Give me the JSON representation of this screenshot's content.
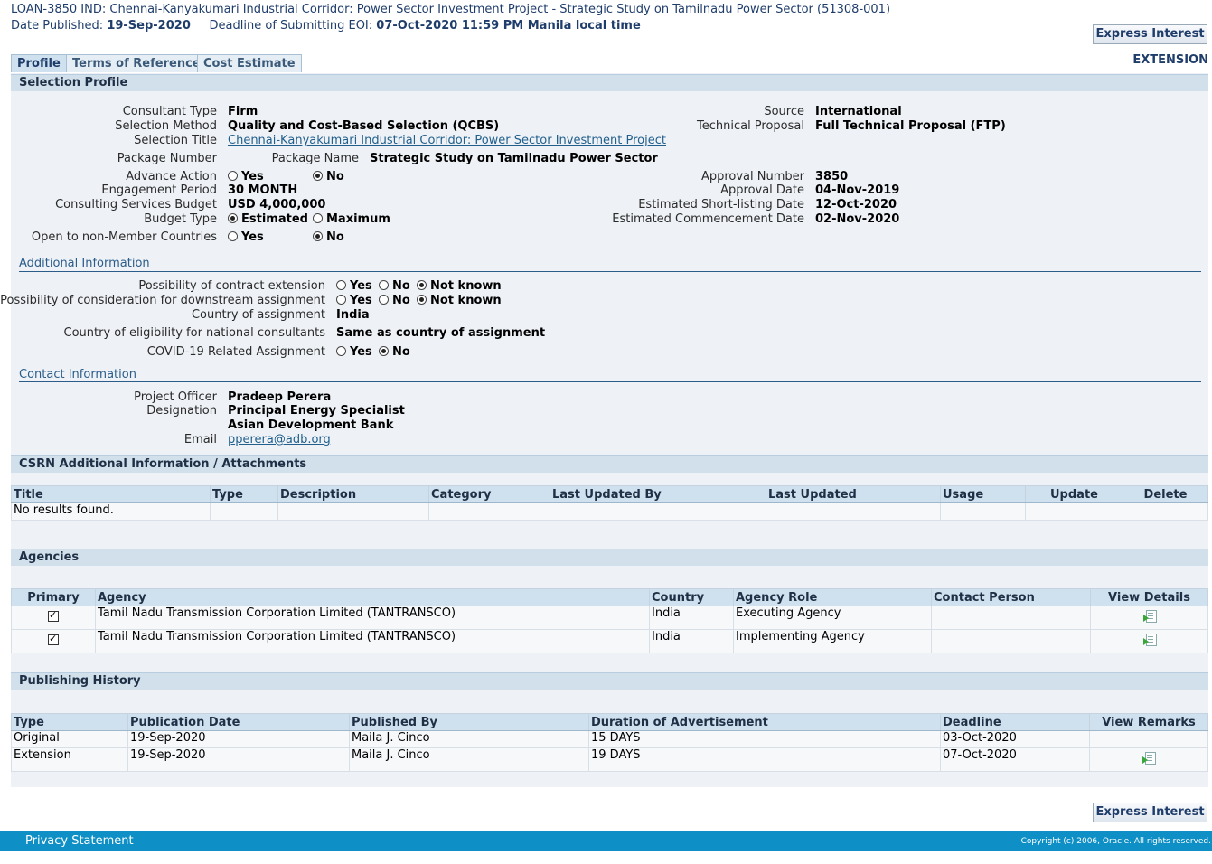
{
  "header": {
    "title": "LOAN-3850 IND: Chennai-Kanyakumari Industrial Corridor: Power Sector Investment Project - Strategic Study on Tamilnadu Power Sector (51308-001)",
    "date_published_label": "Date Published:",
    "date_published": "19-Sep-2020",
    "deadline_label": "Deadline of Submitting EOI:",
    "deadline": "07-Oct-2020 11:59 PM Manila local time",
    "express_interest": "Express Interest",
    "extension_label": "EXTENSION"
  },
  "tabs": [
    {
      "label": "Profile",
      "active": true
    },
    {
      "label": "Terms of Reference",
      "active": false
    },
    {
      "label": "Cost Estimate",
      "active": false
    }
  ],
  "selection_profile": {
    "heading": "Selection Profile",
    "consultant_type_label": "Consultant Type",
    "consultant_type": "Firm",
    "selection_method_label": "Selection Method",
    "selection_method": "Quality and Cost-Based Selection (QCBS)",
    "selection_title_label": "Selection Title",
    "selection_title": "Chennai-Kanyakumari Industrial Corridor: Power Sector Investment Project",
    "package_number_label": "Package Number",
    "package_name_label": "Package Name",
    "package_name": "Strategic Study on Tamilnadu Power Sector",
    "advance_action_label": "Advance Action",
    "engagement_period_label": "Engagement Period",
    "engagement_period": "30 MONTH",
    "budget_label": "Consulting Services Budget",
    "budget": "USD 4,000,000",
    "budget_type_label": "Budget Type",
    "budget_type_estimated": "Estimated",
    "budget_type_maximum": "Maximum",
    "non_member_label": "Open to non-Member Countries",
    "yes": "Yes",
    "no": "No",
    "source_label": "Source",
    "source": "International",
    "tech_proposal_label": "Technical Proposal",
    "tech_proposal": "Full Technical Proposal (FTP)",
    "approval_number_label": "Approval Number",
    "approval_number": "3850",
    "approval_date_label": "Approval Date",
    "approval_date": "04-Nov-2019",
    "shortlisting_label": "Estimated Short-listing Date",
    "shortlisting_date": "12-Oct-2020",
    "commencement_label": "Estimated Commencement Date",
    "commencement_date": "02-Nov-2020"
  },
  "additional_info": {
    "heading": "Additional Information",
    "contract_ext_label": "Possibility of contract extension",
    "downstream_label": "Possibility of consideration for downstream assignment",
    "country_label": "Country of assignment",
    "country": "India",
    "eligibility_label": "Country of eligibility for national consultants",
    "eligibility": "Same as country of assignment",
    "covid_label": "COVID-19 Related Assignment",
    "yes": "Yes",
    "no": "No",
    "not_known": "Not known"
  },
  "contact_info": {
    "heading": "Contact Information",
    "officer_label": "Project Officer",
    "officer": "Pradeep Perera",
    "designation_label": "Designation",
    "designation": "Principal Energy Specialist",
    "organization": "Asian Development Bank",
    "email_label": "Email",
    "email": "pperera@adb.org"
  },
  "attachments": {
    "heading": "CSRN Additional Information / Attachments",
    "columns": [
      "Title",
      "Type",
      "Description",
      "Category",
      "Last Updated By",
      "Last Updated",
      "Usage",
      "Update",
      "Delete"
    ],
    "empty_text": "No results found."
  },
  "agencies": {
    "heading": "Agencies",
    "columns": [
      "Primary",
      "Agency",
      "Country",
      "Agency Role",
      "Contact Person",
      "View Details"
    ],
    "rows": [
      {
        "primary": true,
        "agency": "Tamil Nadu Transmission Corporation Limited (TANTRANSCO)",
        "country": "India",
        "role": "Executing Agency",
        "contact": ""
      },
      {
        "primary": true,
        "agency": "Tamil Nadu Transmission Corporation Limited (TANTRANSCO)",
        "country": "India",
        "role": "Implementing Agency",
        "contact": ""
      }
    ]
  },
  "publishing_history": {
    "heading": "Publishing History",
    "columns": [
      "Type",
      "Publication Date",
      "Published By",
      "Duration of Advertisement",
      "Deadline",
      "View Remarks"
    ],
    "rows": [
      {
        "type": "Original",
        "pub_date": "19-Sep-2020",
        "by": "Maila J. Cinco",
        "duration": "15 DAYS",
        "deadline": "03-Oct-2020",
        "remarks_icon": false
      },
      {
        "type": "Extension",
        "pub_date": "19-Sep-2020",
        "by": "Maila J. Cinco",
        "duration": "19 DAYS",
        "deadline": "07-Oct-2020",
        "remarks_icon": true
      }
    ]
  },
  "footer": {
    "privacy": "Privacy Statement",
    "copyright": "Copyright (c) 2006, Oracle. All rights reserved."
  }
}
